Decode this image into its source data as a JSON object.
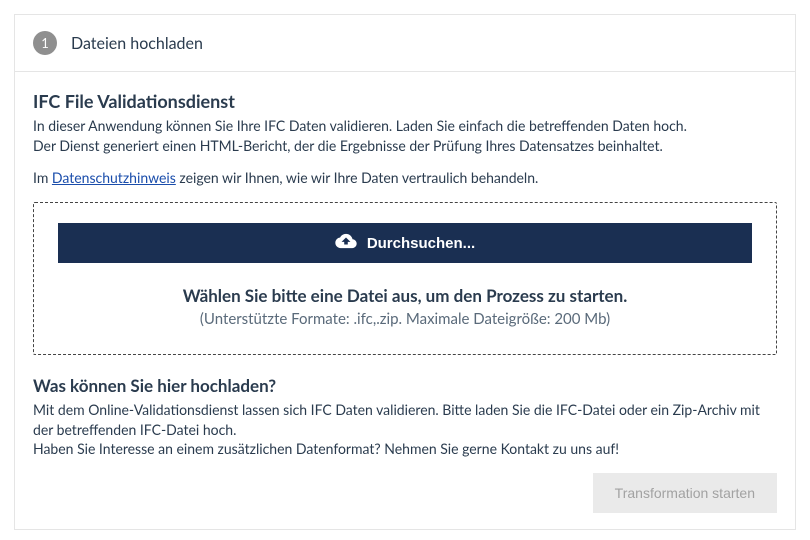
{
  "step": {
    "number": "1",
    "title": "Dateien hochladen"
  },
  "main": {
    "heading": "IFC File Validationsdienst",
    "intro1": "In dieser Anwendung können Sie Ihre IFC Daten validieren. Laden Sie einfach die betreffenden Daten hoch.",
    "intro2": "Der Dienst generiert einen HTML-Bericht, der die Ergebnisse der Prüfung Ihres Datensatzes beinhaltet.",
    "privacy_prefix": "Im ",
    "privacy_link": "Datenschutzhinweis",
    "privacy_suffix": " zeigen wir Ihnen, wie wir Ihre Daten vertraulich behandeln."
  },
  "dropzone": {
    "browse_label": "Durchsuchen...",
    "hint_main": "Wählen Sie bitte eine Datei aus, um den Prozess zu starten.",
    "hint_sub": "(Unterstützte Formate: .ifc,.zip. Maximale Dateigröße: 200 Mb)"
  },
  "help": {
    "heading": "Was können Sie hier hochladen?",
    "line1": "Mit dem Online-Validationsdienst lassen sich IFC Daten validieren. Bitte laden Sie die IFC-Datei oder ein Zip-Archiv mit der betreffenden IFC-Datei hoch.",
    "line2": "Haben Sie Interesse an einem zusätzlichen Datenformat? Nehmen Sie gerne Kontakt zu uns auf!"
  },
  "footer": {
    "start_label": "Transformation starten"
  }
}
